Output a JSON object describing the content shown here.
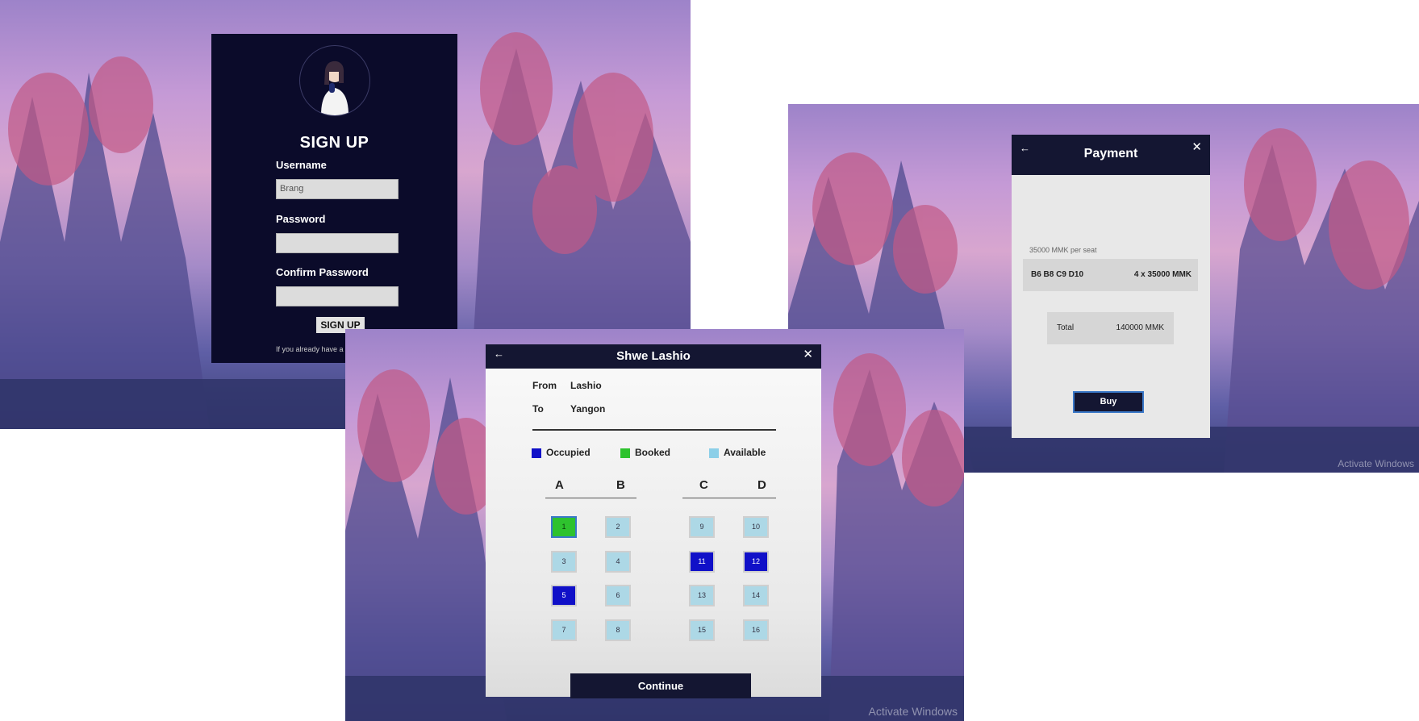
{
  "signup": {
    "title": "SIGN UP",
    "username_label": "Username",
    "username_value": "Brang",
    "password_label": "Password",
    "password_value": "",
    "confirm_label": "Confirm Password",
    "confirm_value": "",
    "button_label": "SIGN UP",
    "footer_text": "If you already have a"
  },
  "payment": {
    "title": "Payment",
    "back_icon": "←",
    "close_icon": "✕",
    "per_seat_text": "35000 MMK per seat",
    "seats_text": "B6 B8 C9 D10",
    "calc_text": "4 x 35000 MMK",
    "total_label": "Total",
    "total_value": "140000 MMK",
    "buy_label": "Buy",
    "watermark": "Activate Windows"
  },
  "seat_selection": {
    "title": "Shwe Lashio",
    "back_icon": "←",
    "close_icon": "✕",
    "from_label": "From",
    "from_value": "Lashio",
    "to_label": "To",
    "to_value": "Yangon",
    "legend": [
      {
        "label": "Occupied",
        "color": "#1010c8"
      },
      {
        "label": "Booked",
        "color": "#2ec22e"
      },
      {
        "label": "Available",
        "color": "#8ccfe8"
      }
    ],
    "columns": [
      "A",
      "B",
      "C",
      "D"
    ],
    "seats": [
      {
        "number": "1",
        "status": "booked"
      },
      {
        "number": "2",
        "status": "available"
      },
      {
        "number": "9",
        "status": "available"
      },
      {
        "number": "10",
        "status": "available"
      },
      {
        "number": "3",
        "status": "available"
      },
      {
        "number": "4",
        "status": "available"
      },
      {
        "number": "11",
        "status": "occupied"
      },
      {
        "number": "12",
        "status": "occupied"
      },
      {
        "number": "5",
        "status": "occupied"
      },
      {
        "number": "6",
        "status": "available"
      },
      {
        "number": "13",
        "status": "available"
      },
      {
        "number": "14",
        "status": "available"
      },
      {
        "number": "7",
        "status": "available"
      },
      {
        "number": "8",
        "status": "available"
      },
      {
        "number": "15",
        "status": "available"
      },
      {
        "number": "16",
        "status": "available"
      }
    ],
    "continue_label": "Continue",
    "watermark": "Activate Windows"
  },
  "colors": {
    "dark_navy": "#141632",
    "signup_bg": "#0b0b2a",
    "occupied": "#1010c8",
    "booked": "#2ec22e",
    "available": "#add8e6"
  }
}
